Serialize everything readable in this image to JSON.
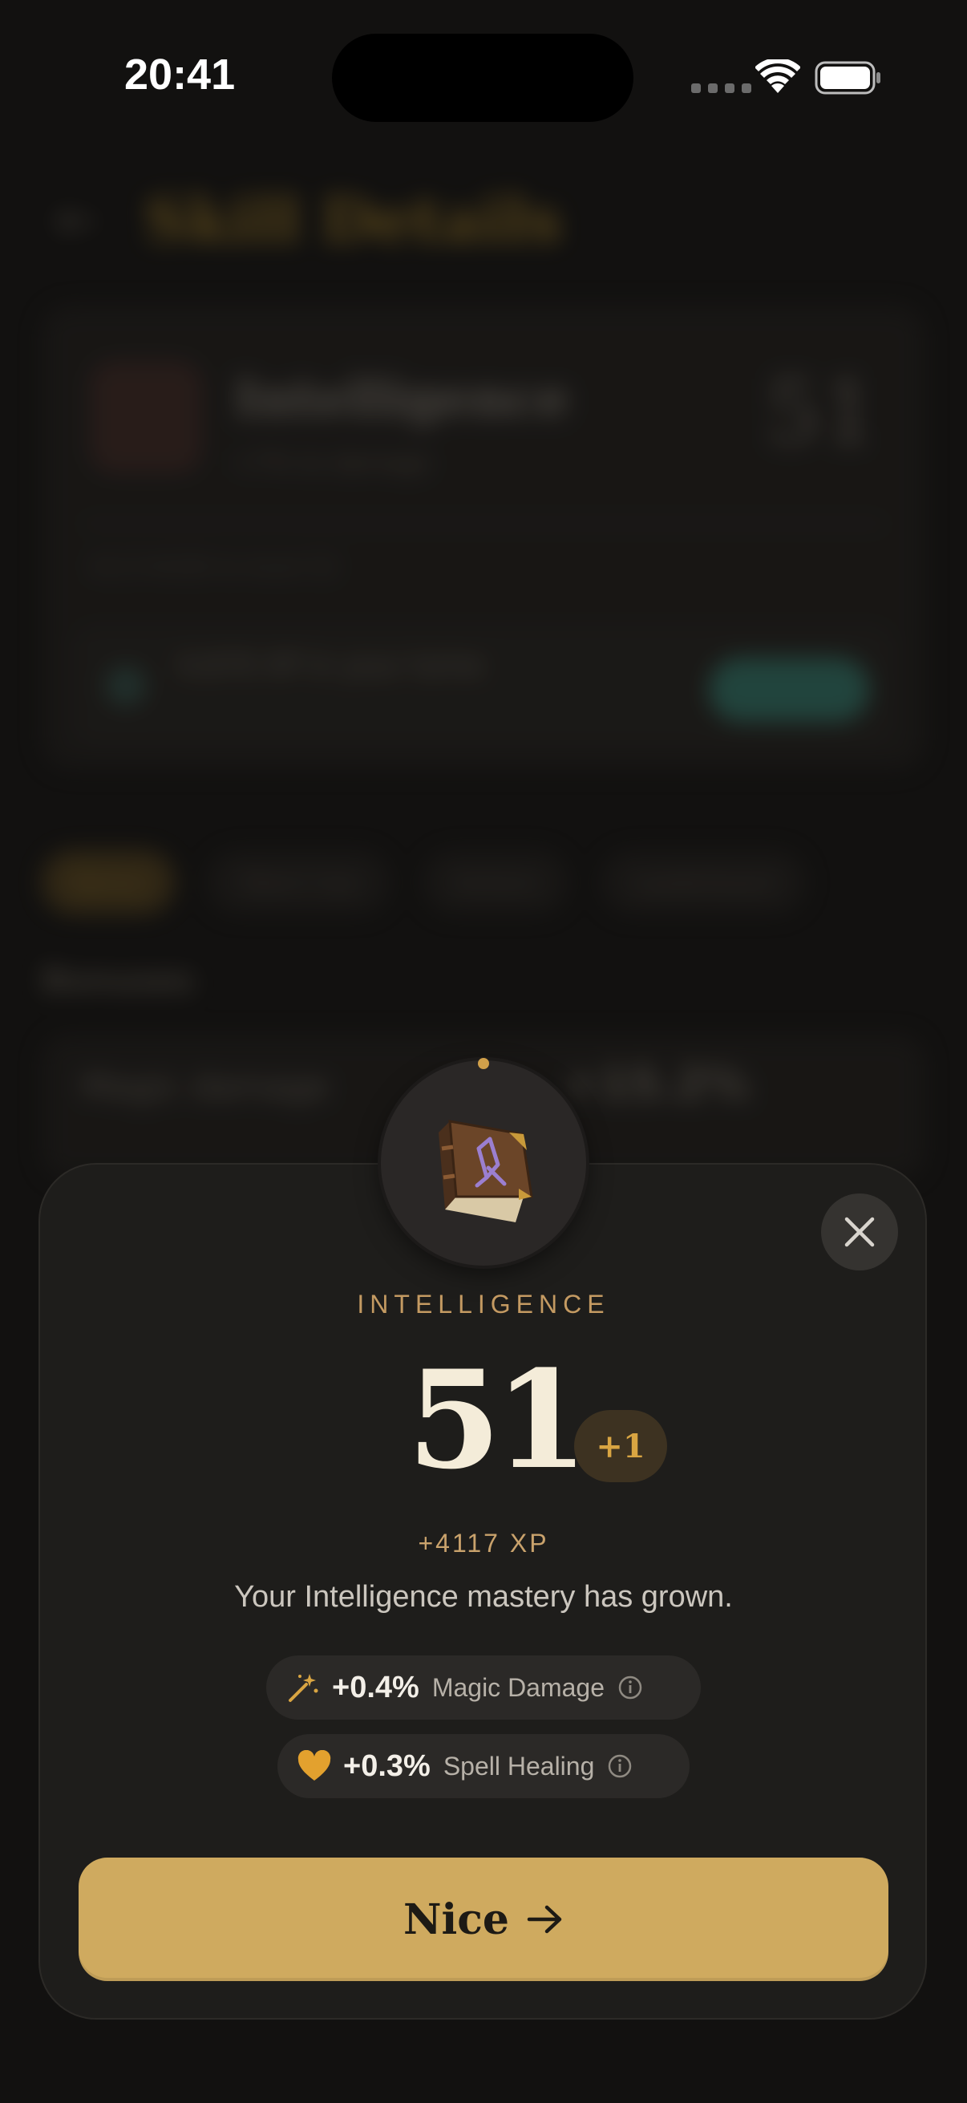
{
  "status_bar": {
    "time": "20:41"
  },
  "background": {
    "back_glyph": "←",
    "title": "Skill Details",
    "card": {
      "kicker": "",
      "name": "Intelligence",
      "subtitle": "+7% to damage",
      "level": "51",
      "xp_row_left": "4117/4200 to level 52",
      "xp_row_right": "",
      "tip_text": "4,670 XP in your tome",
      "tip_sub": "",
      "tip_button": ""
    },
    "tabs": [
      "Bonus",
      "Talent tree",
      "Actions",
      "Leaderboard"
    ],
    "section_title": "Bonuses",
    "section_right": "",
    "list_item": {
      "name": "Magic damage",
      "value": "+15.2%"
    },
    "footer_text": ""
  },
  "modal": {
    "skill_name": "INTELLIGENCE",
    "level": "51",
    "level_delta": "+1",
    "xp_gain": "+4117 XP",
    "message": "Your Intelligence mastery has grown.",
    "bonuses": [
      {
        "icon": "magic-wand-icon",
        "value": "+0.4%",
        "label": "Magic Damage"
      },
      {
        "icon": "heart-icon",
        "value": "+0.3%",
        "label": "Spell Healing"
      }
    ],
    "confirm_label": "Nice"
  },
  "colors": {
    "accent_gold": "#cfaa5f",
    "level_delta_text": "#d9a542",
    "skill_name": "#c49a62",
    "sheet_bg": "#1e1d1b"
  }
}
